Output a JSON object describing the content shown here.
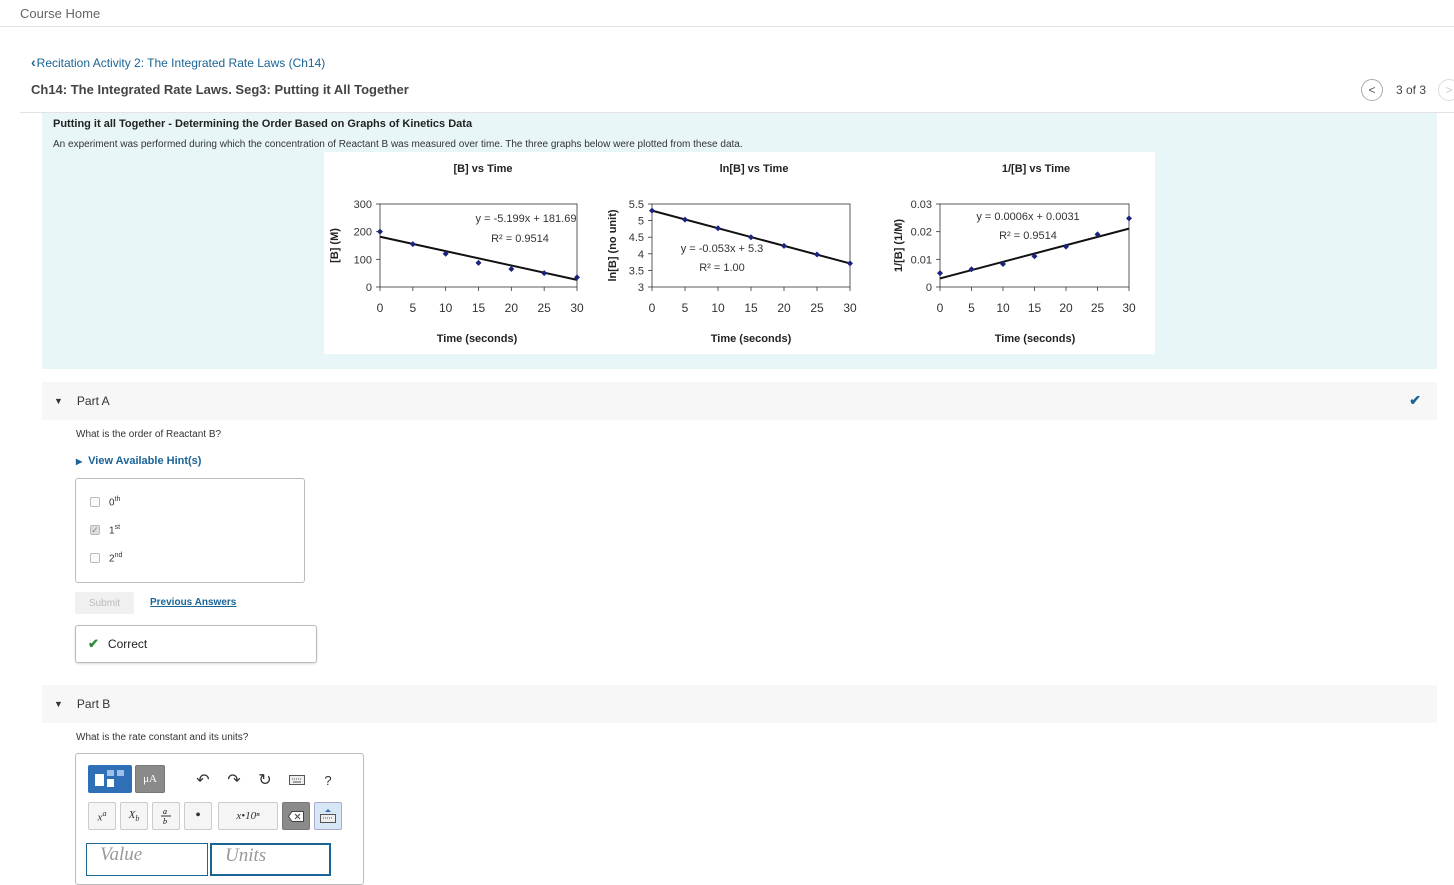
{
  "nav": {
    "course_home": "Course Home",
    "back_link": "Recitation Activity 2: The Integrated Rate Laws (Ch14)",
    "page_title": "Ch14: The Integrated Rate Laws. Seg3: Putting it All Together",
    "pager_text": "3 of 3"
  },
  "intro": {
    "title": "Putting it all Together - Determining the Order Based on Graphs of Kinetics Data",
    "text": "An experiment was performed during which the concentration of Reactant B was measured over time. The three graphs below were plotted from these data."
  },
  "chart_data": [
    {
      "type": "scatter",
      "title": "[B] vs Time",
      "xlabel": "Time (seconds)",
      "ylabel": "[B] (M)",
      "xlim": [
        0,
        30
      ],
      "ylim": [
        0,
        300
      ],
      "xticks": [
        "0",
        "5",
        "10",
        "15",
        "20",
        "25",
        "30"
      ],
      "yticks": [
        "0",
        "100",
        "200",
        "300"
      ],
      "x": [
        0,
        5,
        10,
        15,
        20,
        25,
        30
      ],
      "y": [
        200,
        155,
        120,
        87,
        65,
        50,
        35
      ],
      "trendline": {
        "slope": -5.199,
        "intercept": 181.69
      },
      "equation": "y = -5.199x + 181.69",
      "r2": "R² = 0.9514"
    },
    {
      "type": "scatter",
      "title": "ln[B] vs Time",
      "xlabel": "Time (seconds)",
      "ylabel": "ln[B] (no unit)",
      "xlim": [
        0,
        30
      ],
      "ylim": [
        3,
        5.5
      ],
      "xticks": [
        "0",
        "5",
        "10",
        "15",
        "20",
        "25",
        "30"
      ],
      "yticks": [
        "3",
        "3.5",
        "4",
        "4.5",
        "5",
        "5.5"
      ],
      "x": [
        0,
        5,
        10,
        15,
        20,
        25,
        30
      ],
      "y": [
        5.3,
        5.03,
        4.77,
        4.5,
        4.24,
        3.98,
        3.71
      ],
      "trendline": {
        "slope": -0.053,
        "intercept": 5.3
      },
      "equation": "y = -0.053x + 5.3",
      "r2": "R² = 1.00"
    },
    {
      "type": "scatter",
      "title": "1/[B] vs Time",
      "xlabel": "Time (seconds)",
      "ylabel": "1/[B] (1/M)",
      "xlim": [
        0,
        30
      ],
      "ylim": [
        0,
        0.03
      ],
      "xticks": [
        "0",
        "5",
        "10",
        "15",
        "20",
        "25",
        "30"
      ],
      "yticks": [
        "0",
        "0.01",
        "0.02",
        "0.03"
      ],
      "x": [
        0,
        5,
        10,
        15,
        20,
        25,
        30
      ],
      "y": [
        0.005,
        0.0064,
        0.0083,
        0.0111,
        0.0146,
        0.019,
        0.0248
      ],
      "trendline": {
        "slope": 0.0006,
        "intercept": 0.0031
      },
      "equation": "y = 0.0006x + 0.0031",
      "r2": "R² = 0.9514"
    }
  ],
  "part_a": {
    "name": "Part A",
    "question": "What is the order of Reactant B?",
    "hint": "View Available Hint(s)",
    "choices": [
      {
        "base": "0",
        "sup": "th",
        "checked": false
      },
      {
        "base": "1",
        "sup": "st",
        "checked": true
      },
      {
        "base": "2",
        "sup": "nd",
        "checked": false
      }
    ],
    "submit": "Submit",
    "previous_answers": "Previous Answers",
    "feedback": "Correct"
  },
  "part_b": {
    "name": "Part B",
    "question": "What is the rate constant and its units?",
    "toolbar": {
      "mu_a": "μA",
      "help": "?",
      "sci": "x•10ⁿ"
    },
    "value_placeholder": "Value",
    "units_placeholder": "Units"
  },
  "colors": {
    "link": "#1a6496",
    "intro_bg": "#e8f6f7",
    "marker": "#1a237e",
    "correct": "#2e8b3a"
  }
}
